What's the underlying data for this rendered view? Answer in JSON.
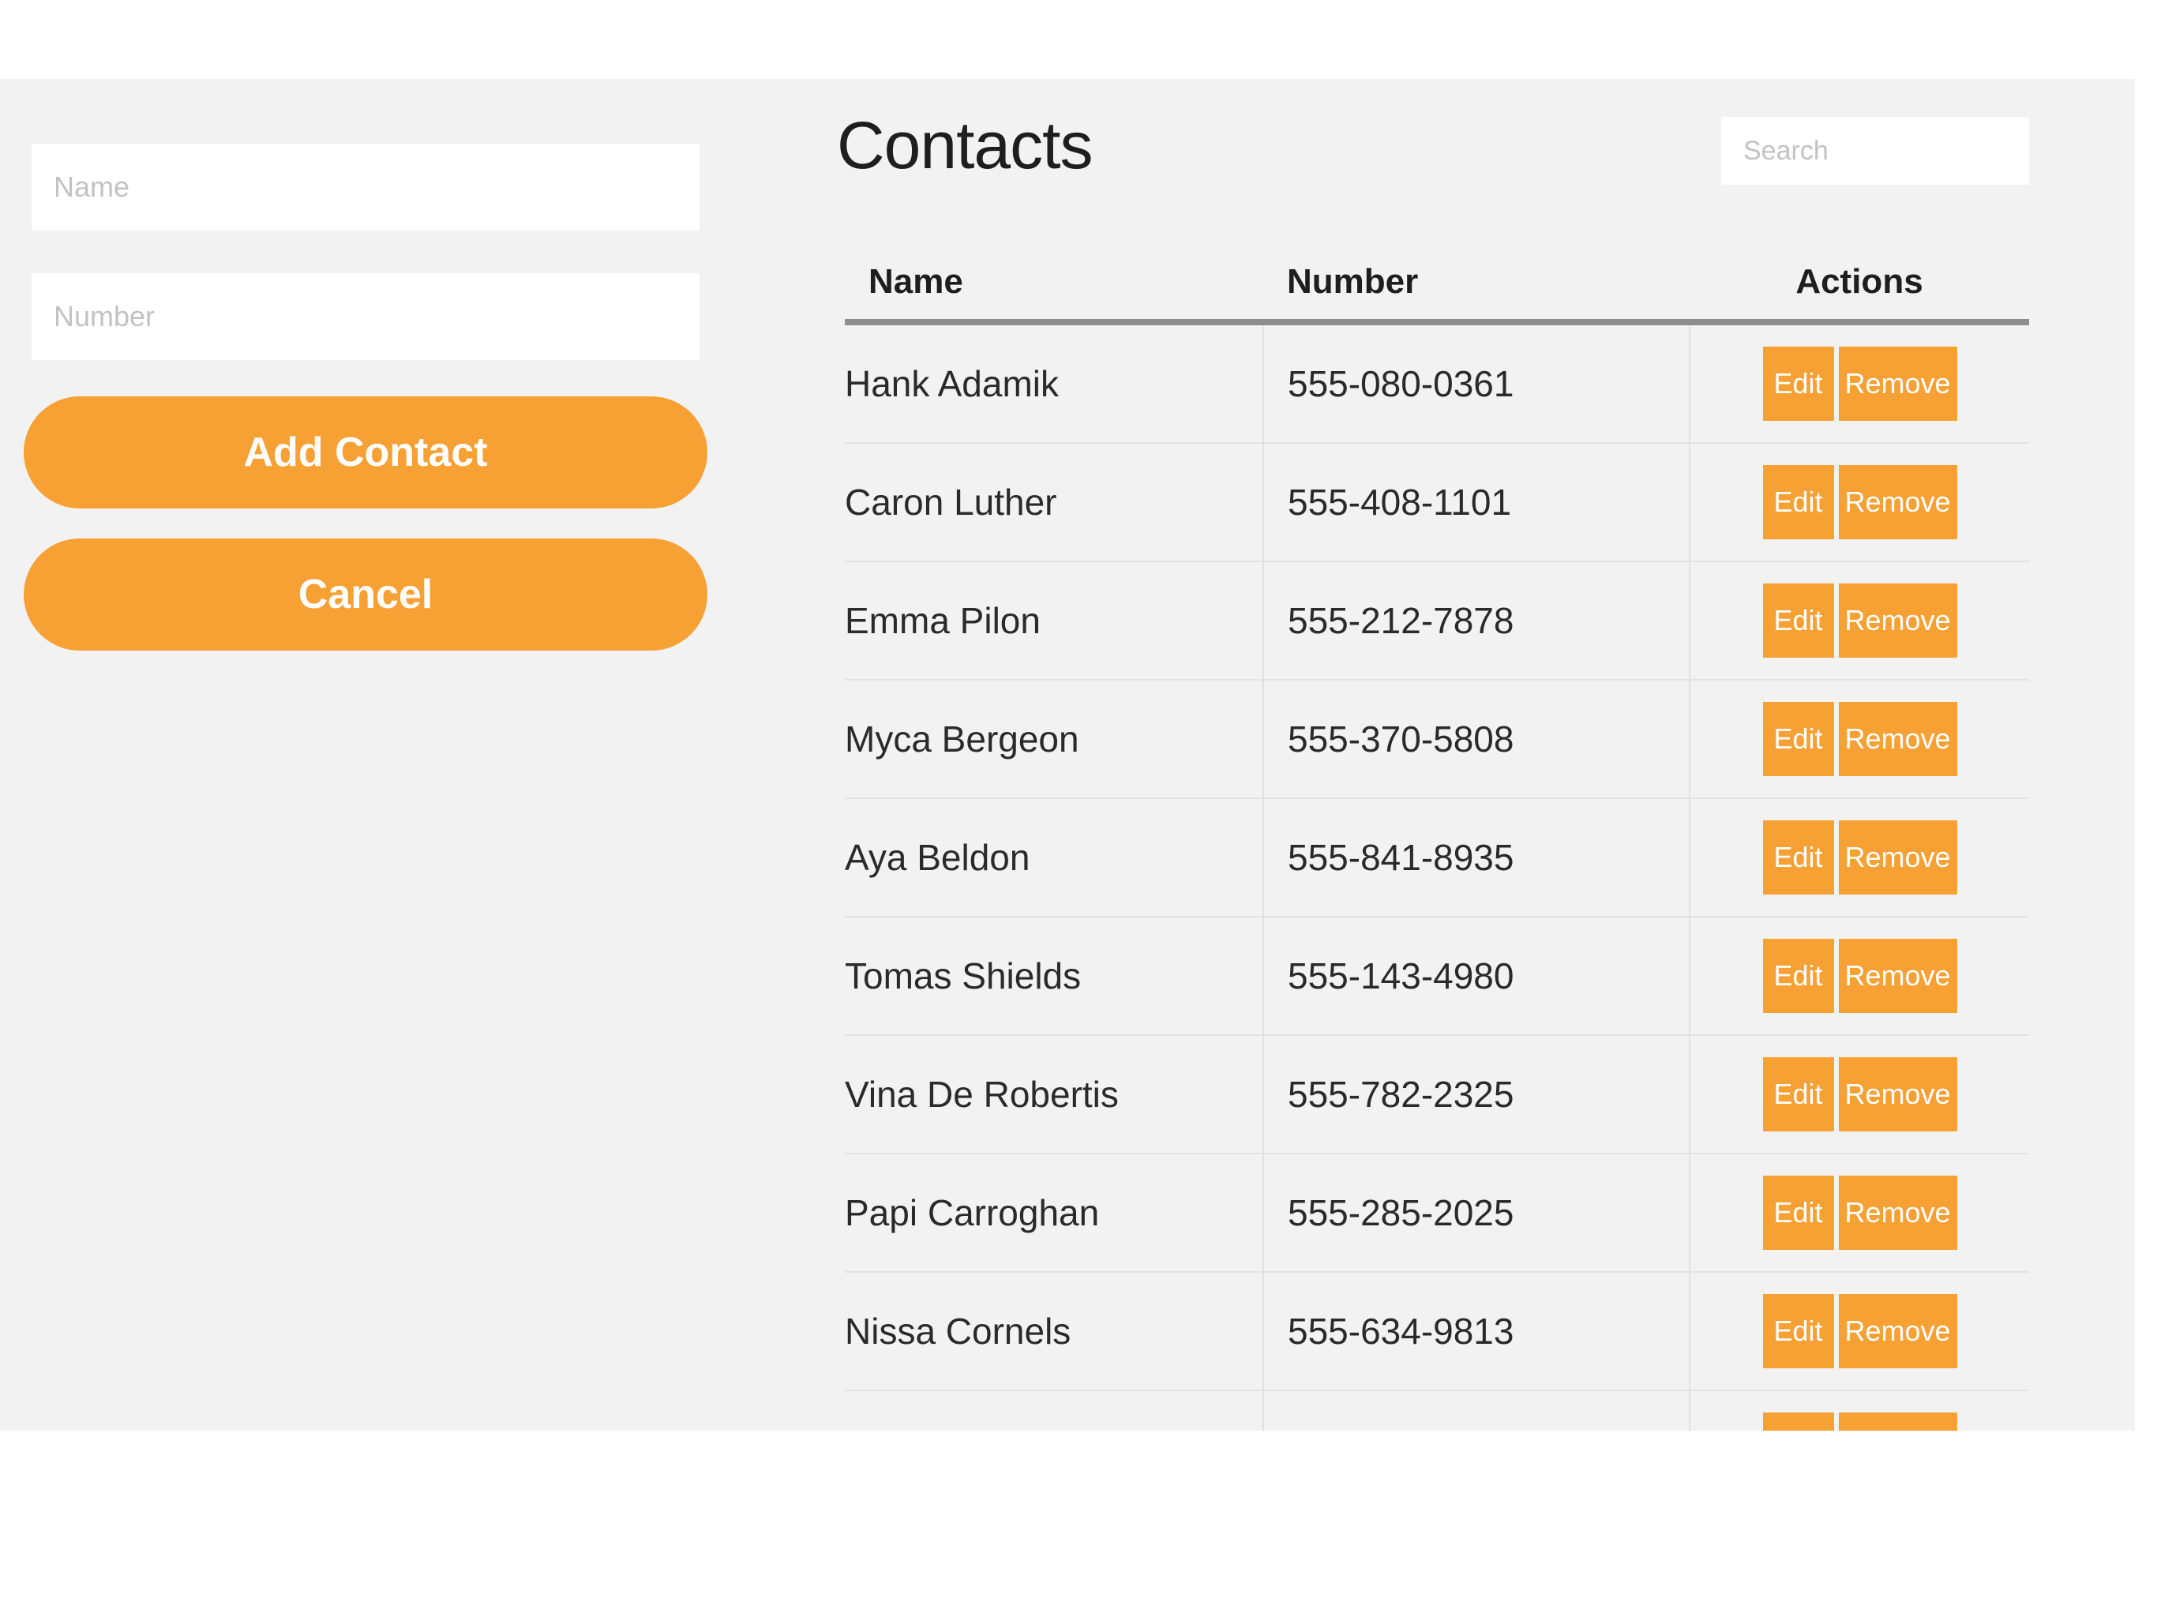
{
  "theme": {
    "accent": "#f7a034",
    "panel_bg": "#f2f2f2"
  },
  "form": {
    "name_placeholder": "Name",
    "number_placeholder": "Number",
    "add_label": "Add Contact",
    "cancel_label": "Cancel"
  },
  "main": {
    "title": "Contacts",
    "search_placeholder": "Search"
  },
  "table": {
    "headers": {
      "name": "Name",
      "number": "Number",
      "actions": "Actions"
    },
    "edit_label": "Edit",
    "remove_label": "Remove",
    "rows": [
      {
        "name": "Hank Adamik",
        "number": "555-080-0361"
      },
      {
        "name": "Caron Luther",
        "number": "555-408-1101"
      },
      {
        "name": "Emma Pilon",
        "number": "555-212-7878"
      },
      {
        "name": "Myca Bergeon",
        "number": "555-370-5808"
      },
      {
        "name": "Aya Beldon",
        "number": "555-841-8935"
      },
      {
        "name": "Tomas Shields",
        "number": "555-143-4980"
      },
      {
        "name": "Vina De Robertis",
        "number": "555-782-2325"
      },
      {
        "name": "Papi Carroghan",
        "number": "555-285-2025"
      },
      {
        "name": "Nissa Cornels",
        "number": "555-634-9813"
      },
      {
        "name": "",
        "number": ""
      }
    ]
  }
}
